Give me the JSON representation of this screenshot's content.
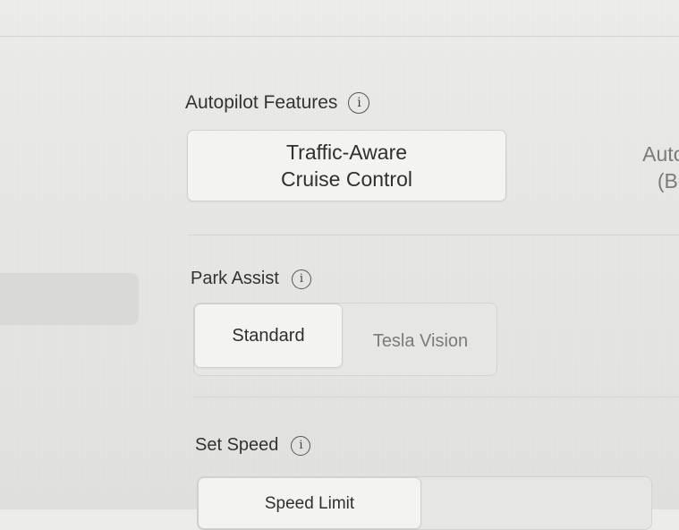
{
  "autopilot": {
    "label": "Autopilot Features",
    "info_icon": "info-icon",
    "options": [
      {
        "line1": "Traffic-Aware",
        "line2": "Cruise Control",
        "selected": true
      },
      {
        "line1": "Autos",
        "line2": "(Bet",
        "selected": false
      }
    ]
  },
  "park_assist": {
    "label": "Park Assist",
    "info_icon": "info-icon",
    "options": [
      {
        "label": "Standard",
        "selected": true
      },
      {
        "label": "Tesla Vision",
        "selected": false
      }
    ]
  },
  "set_speed": {
    "label": "Set Speed",
    "info_icon": "info-icon",
    "options": [
      {
        "label": "Speed Limit",
        "selected": true
      }
    ]
  },
  "colors": {
    "background": "#e7e7e5",
    "selected_segment": "#f3f3f1",
    "unselected_text": "#7b7b7b",
    "label_text": "#333333"
  }
}
